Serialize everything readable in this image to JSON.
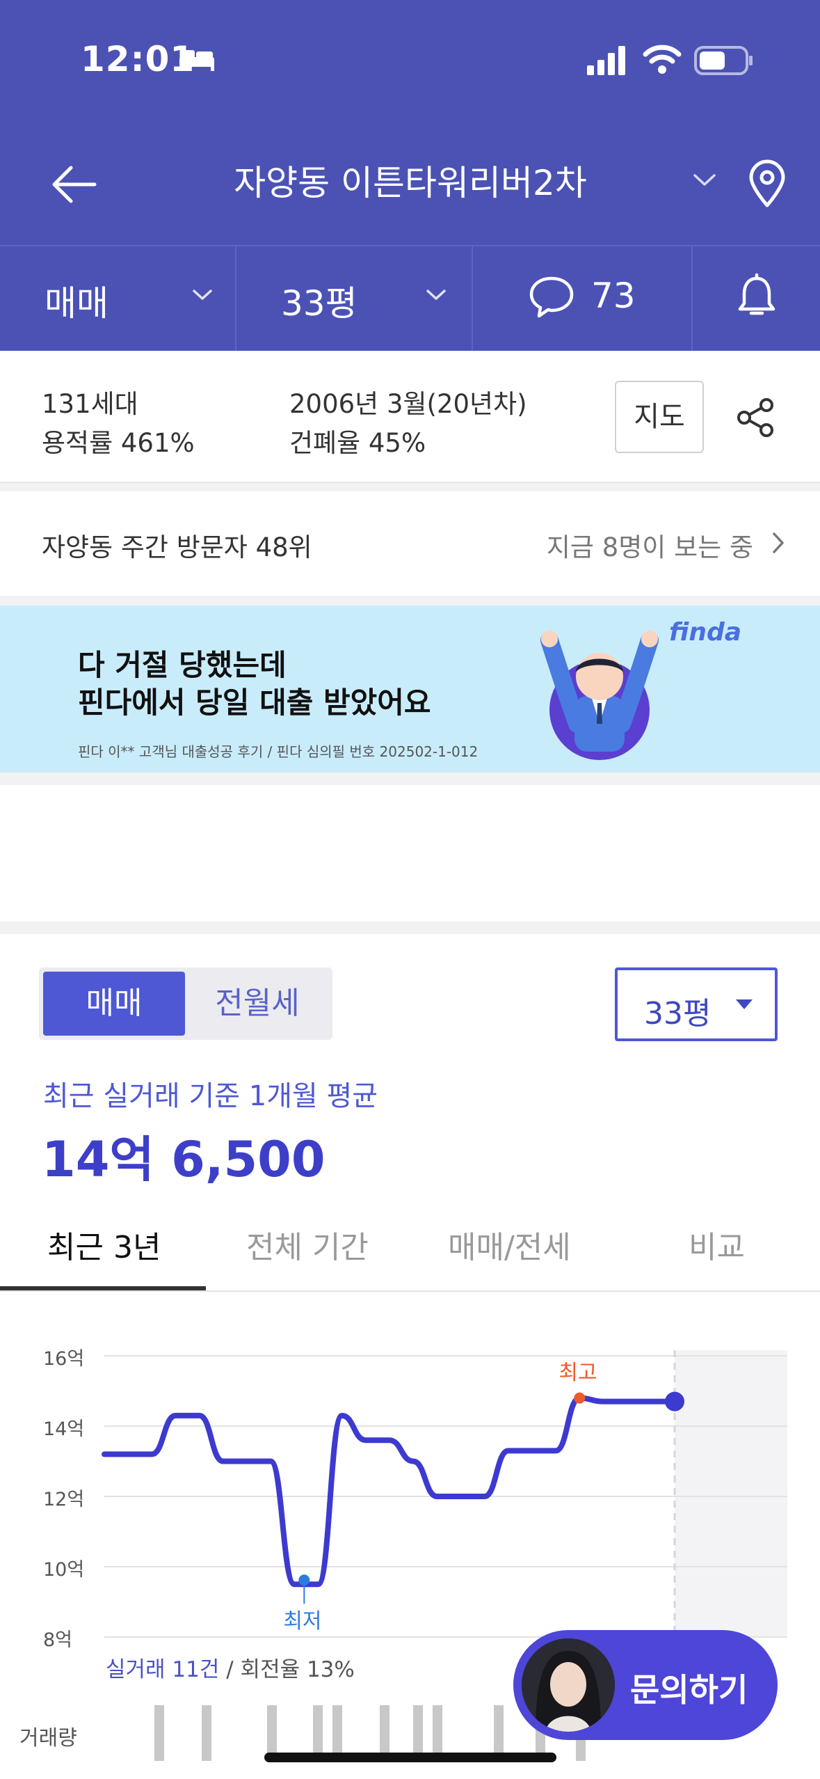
{
  "status_bar": {
    "time": "12:01"
  },
  "header": {
    "title": "자양동 이튼타워리버2차"
  },
  "filters": {
    "trade_type": "매매",
    "size": "33평",
    "comment_count": "73"
  },
  "info": {
    "households": "131세대",
    "floor_area_ratio": "용적률 461%",
    "built": "2006년 3월(20년차)",
    "building_coverage": "건폐율 45%",
    "map_label": "지도"
  },
  "visitors": {
    "rank": "자양동 주간 방문자 48위",
    "now_viewing": "지금 8명이 보는 중"
  },
  "ad": {
    "line1": "다 거절 당했는데",
    "line2": "핀다에서 당일 대출 받았어요",
    "fine_print": "핀다 이** 고객님 대출성공 후기 / 핀다 심의필 번호 202502-1-012",
    "brand": "finda"
  },
  "price": {
    "tab_sale": "매매",
    "tab_rent": "전월세",
    "size_value": "33평",
    "caption": "최근 실거래 기준 1개월 평균",
    "amount": "14억 6,500"
  },
  "range_tabs": [
    "최근 3년",
    "전체 기간",
    "매매/전세",
    "비교"
  ],
  "chart_data": {
    "type": "line",
    "y_ticks": [
      "16억",
      "14억",
      "12억",
      "10억",
      "8억"
    ],
    "ylim": [
      8,
      16
    ],
    "y_unit": "억",
    "series": [
      {
        "values": [
          13.2,
          13.2,
          13.2,
          14.3,
          14.3,
          13.0,
          13.0,
          13.0,
          9.5,
          9.5,
          14.3,
          13.6,
          13.6,
          13.0,
          12.0,
          12.0,
          12.0,
          13.3,
          13.3,
          13.3,
          14.8,
          14.7,
          14.7,
          14.7,
          14.7
        ]
      }
    ],
    "highest_label": "최고",
    "lowest_label": "최저",
    "highest_value": 14.8,
    "lowest_value": 9.5,
    "latest_value": 14.7,
    "volume": [
      1,
      1,
      1,
      1,
      1,
      1,
      1,
      1,
      1,
      1,
      1
    ],
    "grid": true,
    "colors": {
      "line": "#3d3ad0",
      "high": "#f05a28",
      "low": "#2e7be0"
    }
  },
  "deals": {
    "count": "실거래 11건",
    "turnover": " / 회전율 13%"
  },
  "volume_label": "거래량",
  "inquiry": {
    "label": "문의하기"
  }
}
